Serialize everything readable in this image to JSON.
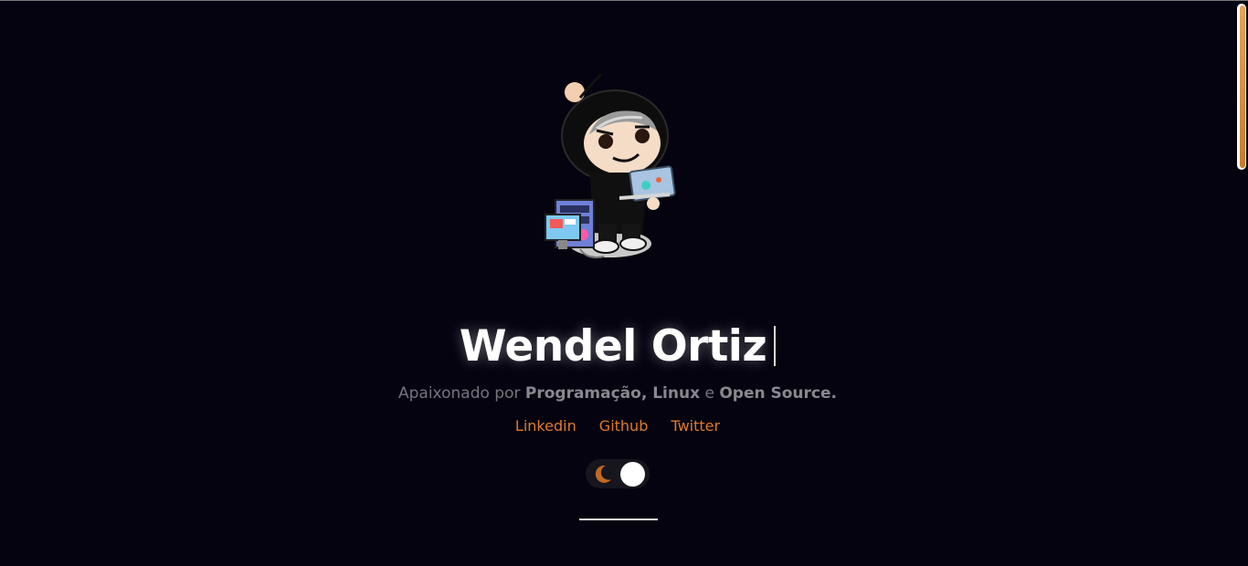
{
  "profile": {
    "name": "Wendel Ortiz",
    "tagline": {
      "prefix": "Apaixonado por ",
      "bold1": "Programação, Linux",
      "middle": " e ",
      "bold2": "Open Source."
    }
  },
  "links": [
    {
      "label": "Linkedin"
    },
    {
      "label": "Github"
    },
    {
      "label": "Twitter"
    }
  ],
  "theme_toggle": {
    "icon": "moon-icon",
    "state": "dark"
  },
  "colors": {
    "background": "#05030f",
    "accent": "#e07a2a",
    "title": "#ffffff",
    "muted_text": "#77747e"
  }
}
